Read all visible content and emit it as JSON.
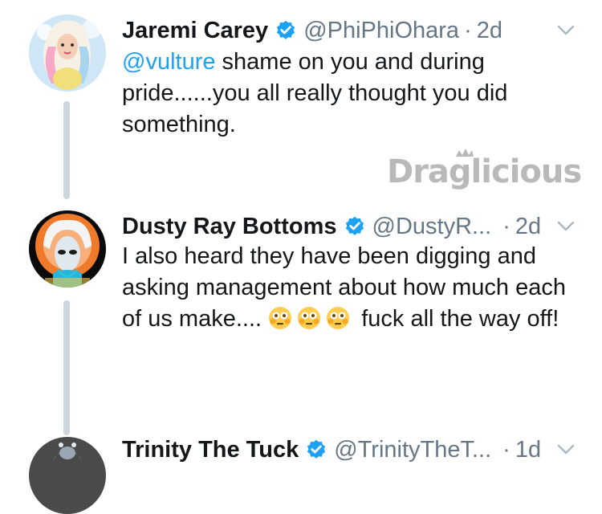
{
  "tweets": [
    {
      "name": "Jaremi Carey",
      "handle": "@PhiPhiOhara",
      "dot": "·",
      "time": "2d",
      "mention": "@vulture",
      "text_after_mention": " shame on you and during pride......you all really thought you did something."
    },
    {
      "name": "Dusty Ray Bottoms",
      "handle": "@DustyR...",
      "dot": "·",
      "time": "2d",
      "text_part1": "I also heard they have been digging and asking management about how much each of us make....",
      "emojis": [
        "flushed-face",
        "flushed-face",
        "flushed-face"
      ],
      "text_part2": " fuck all the way off!"
    },
    {
      "name": "Trinity The Tuck",
      "handle": "@TrinityTheT...",
      "dot": "·",
      "time": "1d"
    }
  ],
  "watermark": "Draglicious",
  "colors": {
    "link": "#1da1f2",
    "secondary": "#657786",
    "thread_line": "#ccd6dd",
    "verified": "#1da1f2"
  }
}
